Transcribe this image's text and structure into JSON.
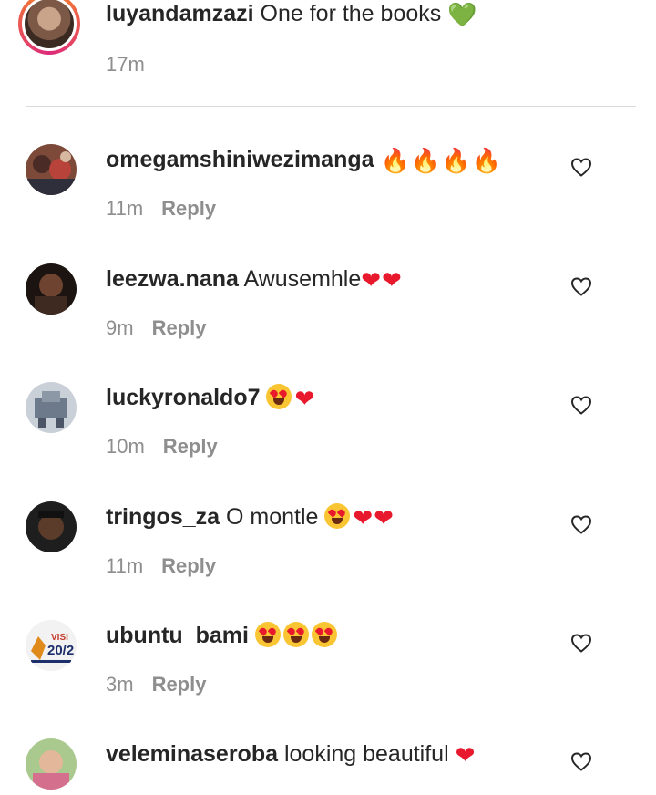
{
  "caption": {
    "username": "luyandamzazi",
    "text": "One for the books",
    "emoji": "💚",
    "time": "17m"
  },
  "reply_label": "Reply",
  "comments": [
    {
      "username": "omegamshiniwezimanga",
      "text": "",
      "time": "11m",
      "emoji": "🔥🔥🔥🔥",
      "emoji_kind": "fire"
    },
    {
      "username": "leezwa.nana",
      "text": "Awusemhle",
      "time": "9m",
      "emoji": "❤❤",
      "emoji_kind": "heart"
    },
    {
      "username": "luckyronaldo7",
      "text": "",
      "time": "10m",
      "emoji": "😍❤",
      "emoji_kind": "mixed"
    },
    {
      "username": "tringos_za",
      "text": "O montle",
      "time": "11m",
      "emoji": "😍❤❤",
      "emoji_kind": "mixed"
    },
    {
      "username": "ubuntu_bami",
      "text": "",
      "time": "3m",
      "emoji": "😍😍😍",
      "emoji_kind": "faces"
    },
    {
      "username": "veleminaseroba",
      "text": "looking beautiful",
      "time": "",
      "emoji": "❤",
      "emoji_kind": "heart"
    }
  ],
  "icons": {
    "like": "heart-outline-icon"
  },
  "colors": {
    "text": "#262626",
    "secondary": "#8e8e8e",
    "divider": "#dbdbdb",
    "heart": "#e8192c",
    "fire": "#ff6a1a",
    "green_heart": "#5fd12c"
  }
}
